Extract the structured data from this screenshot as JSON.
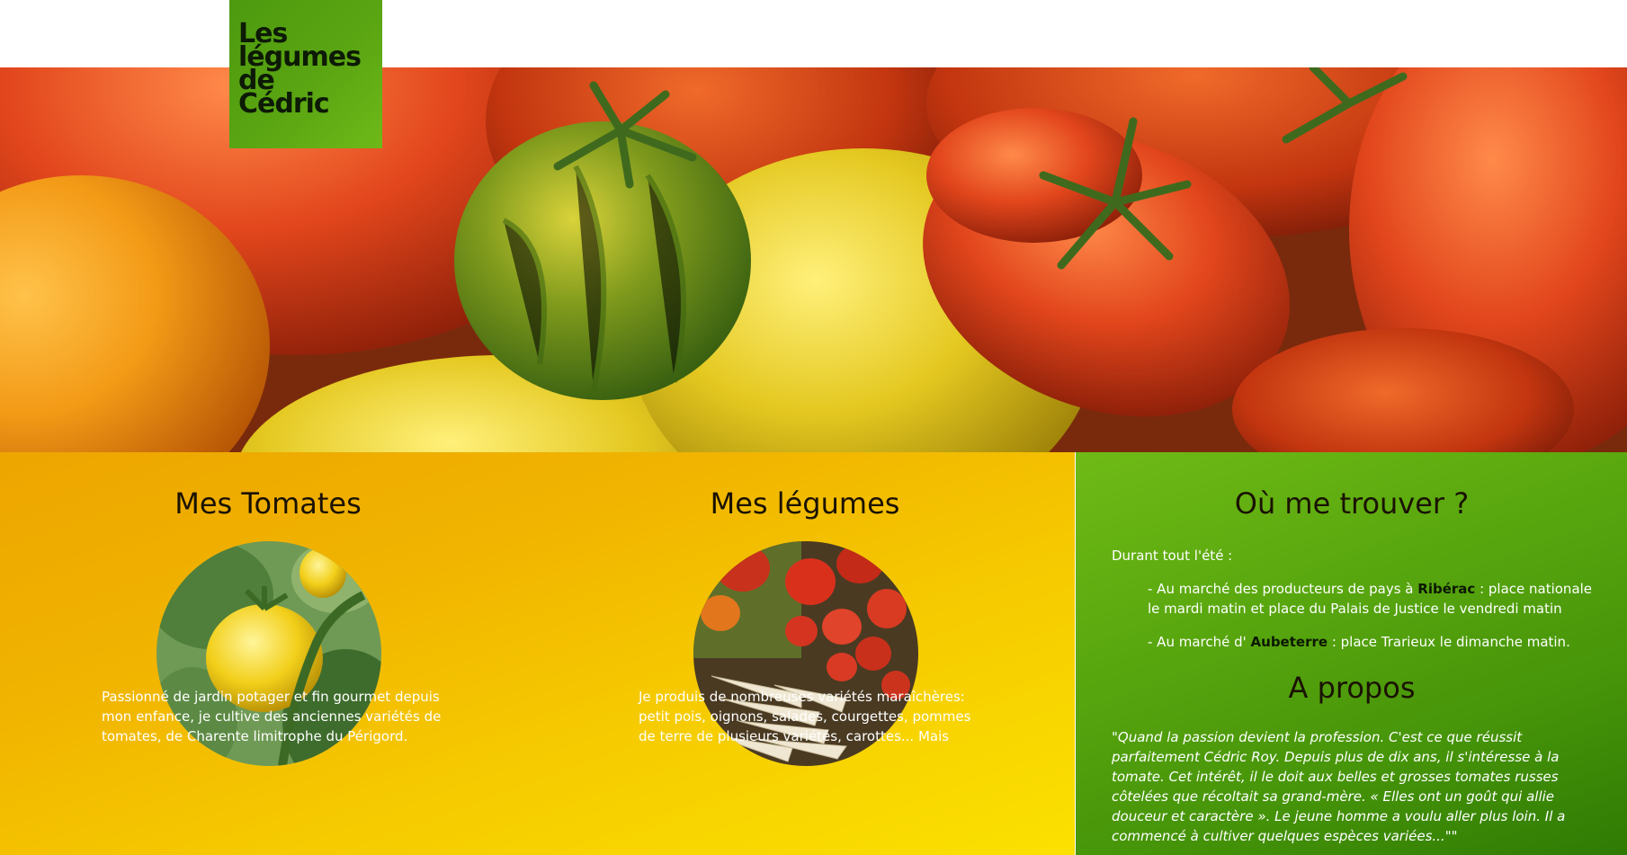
{
  "logo": {
    "lines": [
      "Les",
      "légumes",
      "de",
      "Cédric"
    ]
  },
  "colors": {
    "logo_green": "#5aa512",
    "yellow_panel": "#f1b500",
    "green_panel": "#469409",
    "body_text": "#ffffff",
    "title_text": "#1a1203"
  },
  "hero": {
    "image": "heirloom-tomatoes-photo"
  },
  "tomatoes": {
    "title": "Mes Tomates",
    "image": "yellow-tomato-on-vine-photo",
    "text": "Passionné de jardin potager et fin gourmet depuis mon enfance, je cultive des anciennes variétés de tomates, de Charente limitrophe du Périgord."
  },
  "vegetables": {
    "title": "Mes légumes",
    "image": "squashes-and-parsnips-photo",
    "text": "Je produis de nombreuses variétés maraîchères: petit pois, oignons, salades, courgettes, pommes de terre de plusieurs variétés, carottes... Mais"
  },
  "find_me": {
    "title": "Où me trouver ?",
    "intro": "Durant tout l'été :",
    "market1_prefix": "- Au marché des producteurs de pays à ",
    "market1_link": "Ribérac",
    "market1_suffix": " : place nationale le mardi matin et place du Palais de Justice le vendredi matin",
    "market2_prefix": "- Au marché d' ",
    "market2_link": "Aubeterre",
    "market2_suffix": " : place Trarieux le dimanche matin."
  },
  "about": {
    "title": "A propos",
    "quote": "\"Quand la passion devient la profession. C'est ce que réussit parfaitement Cédric Roy. Depuis plus de dix ans, il s'intéresse à la tomate. Cet intérêt, il le doit aux belles et grosses tomates russes côtelées que récoltait sa grand-mère. « Elles ont un goût qui allie douceur et caractère ». Le jeune homme a voulu aller plus loin. Il a commencé à cultiver quelques espèces variées...\"\""
  }
}
